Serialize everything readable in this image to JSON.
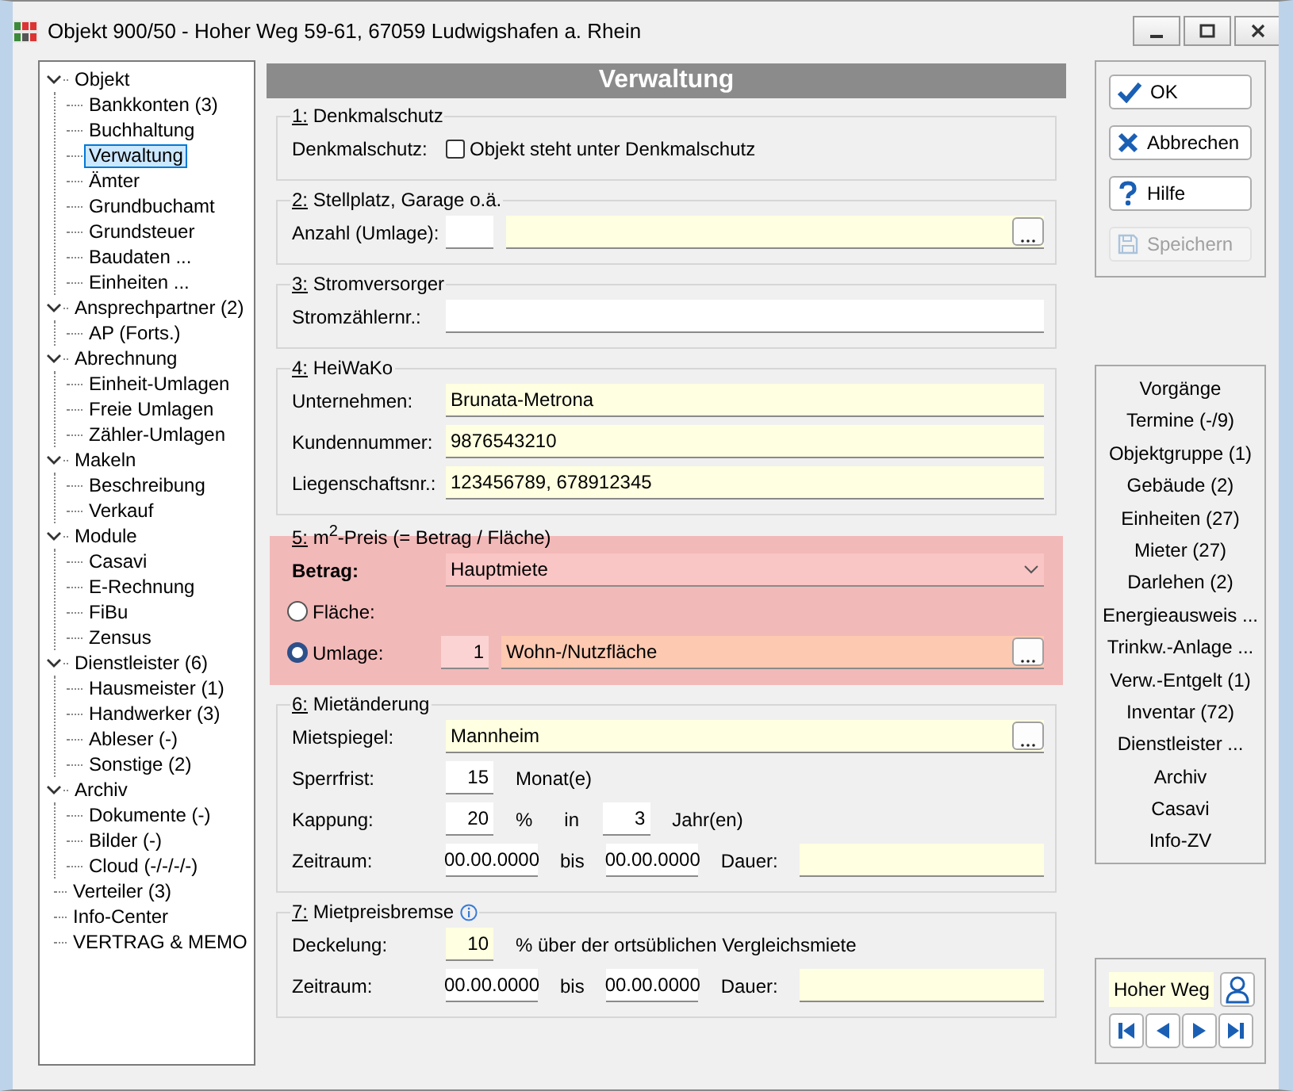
{
  "window": {
    "title": "Objekt 900/50 - Hoher Weg 59-61, 67059 Ludwigshafen a. Rhein"
  },
  "tree": [
    {
      "label": "Objekt",
      "expanded": true,
      "selected": false,
      "children": [
        {
          "label": "Bankkonten (3)",
          "selected": false
        },
        {
          "label": "Buchhaltung",
          "selected": false
        },
        {
          "label": "Verwaltung",
          "selected": true
        },
        {
          "label": "Ämter",
          "selected": false
        },
        {
          "label": "Grundbuchamt",
          "selected": false
        },
        {
          "label": "Grundsteuer",
          "selected": false
        },
        {
          "label": "Baudaten ...",
          "selected": false
        },
        {
          "label": "Einheiten ...",
          "selected": false
        }
      ]
    },
    {
      "label": "Ansprechpartner (2)",
      "expanded": true,
      "selected": false,
      "children": [
        {
          "label": "AP (Forts.)",
          "selected": false
        }
      ]
    },
    {
      "label": "Abrechnung",
      "expanded": true,
      "selected": false,
      "children": [
        {
          "label": "Einheit-Umlagen",
          "selected": false
        },
        {
          "label": "Freie Umlagen",
          "selected": false
        },
        {
          "label": "Zähler-Umlagen",
          "selected": false
        }
      ]
    },
    {
      "label": "Makeln",
      "expanded": true,
      "selected": false,
      "children": [
        {
          "label": "Beschreibung",
          "selected": false
        },
        {
          "label": "Verkauf",
          "selected": false
        }
      ]
    },
    {
      "label": "Module",
      "expanded": true,
      "selected": false,
      "children": [
        {
          "label": "Casavi",
          "selected": false
        },
        {
          "label": "E-Rechnung",
          "selected": false
        },
        {
          "label": "FiBu",
          "selected": false
        },
        {
          "label": "Zensus",
          "selected": false
        }
      ]
    },
    {
      "label": "Dienstleister (6)",
      "expanded": true,
      "selected": false,
      "children": [
        {
          "label": "Hausmeister (1)",
          "selected": false
        },
        {
          "label": "Handwerker (3)",
          "selected": false
        },
        {
          "label": "Ableser (-)",
          "selected": false
        },
        {
          "label": "Sonstige (2)",
          "selected": false
        }
      ]
    },
    {
      "label": "Archiv",
      "expanded": true,
      "selected": false,
      "children": [
        {
          "label": "Dokumente (-)",
          "selected": false
        },
        {
          "label": "Bilder (-)",
          "selected": false
        },
        {
          "label": "Cloud (-/-/-/-)",
          "selected": false
        }
      ]
    },
    {
      "label": "Verteiler (3)",
      "selected": false
    },
    {
      "label": "Info-Center",
      "selected": false
    },
    {
      "label": "VERTRAG & MEMO",
      "selected": false
    }
  ],
  "panel": {
    "title": "Verwaltung",
    "sections": [
      {
        "title": "1: Denkmalschutz",
        "highlighted": false,
        "info": false,
        "rows": [
          {
            "items": [
              {
                "kind": "label",
                "text": "Denkmalschutz:"
              },
              {
                "kind": "checkbox",
                "text": "Objekt steht unter Denkmalschutz",
                "checked": false
              }
            ]
          }
        ]
      },
      {
        "title": "2: Stellplatz, Garage o.ä.",
        "highlighted": false,
        "info": false,
        "rows": [
          {
            "items": [
              {
                "kind": "label",
                "text": "Anzahl (Umlage):"
              },
              {
                "kind": "number",
                "color": "#ffffff"
              },
              {
                "kind": "lookup",
                "color": "#ffffe1"
              }
            ]
          }
        ]
      },
      {
        "title": "3: Stromversorger",
        "highlighted": false,
        "info": false,
        "rows": [
          {
            "items": [
              {
                "kind": "label",
                "text": "Stromzählernr.:"
              },
              {
                "kind": "input",
                "color": "#ffffff"
              }
            ]
          }
        ]
      },
      {
        "title": "4: HeiWaKo",
        "highlighted": false,
        "info": false,
        "rows": [
          {
            "items": [
              {
                "kind": "label",
                "text": "Unternehmen:"
              },
              {
                "kind": "input",
                "value": "Brunata-Metrona",
                "color": "#ffffe1"
              }
            ]
          },
          {
            "items": [
              {
                "kind": "label",
                "text": "Kundennummer:"
              },
              {
                "kind": "input",
                "value": "9876543210",
                "color": "#ffffe1"
              }
            ]
          },
          {
            "items": [
              {
                "kind": "label",
                "text": "Liegenschaftsnr.:"
              },
              {
                "kind": "input",
                "value": "123456789, 678912345",
                "color": "#ffffe1"
              }
            ]
          }
        ]
      },
      {
        "title": "5: m$^{2}$-Preis (= Betrag / Fläche)",
        "highlighted": true,
        "info": false,
        "rows": [
          {
            "items": [
              {
                "kind": "strong-label",
                "text": "Betrag:"
              },
              {
                "kind": "select",
                "value": "Hauptmiete",
                "color": "#fac5c5"
              }
            ]
          },
          {
            "items": [
              {
                "kind": "radio",
                "text": "Fläche:",
                "selected": false
              }
            ]
          },
          {
            "items": [
              {
                "kind": "radio",
                "text": "Umlage:",
                "selected": true
              },
              {
                "kind": "number",
                "value": "1",
                "color": "#fcd3d3"
              },
              {
                "kind": "lookup",
                "value": "Wohn-/Nutzfläche",
                "color": "#fdc9b1"
              }
            ]
          }
        ]
      },
      {
        "title": "6: Mietänderung",
        "highlighted": false,
        "info": false,
        "rows": [
          {
            "items": [
              {
                "kind": "label",
                "text": "Mietspiegel:"
              },
              {
                "kind": "lookup",
                "value": "Mannheim",
                "color": "#ffffe1"
              }
            ]
          },
          {
            "items": [
              {
                "kind": "label",
                "text": "Sperrfrist:"
              },
              {
                "kind": "number",
                "value": "15",
                "color": "#ffffff"
              },
              {
                "kind": "text",
                "text": "Monat(e)"
              }
            ]
          },
          {
            "items": [
              {
                "kind": "label",
                "text": "Kappung:"
              },
              {
                "kind": "number",
                "value": "20",
                "color": "#ffffff"
              },
              {
                "kind": "text",
                "text": "%"
              },
              {
                "kind": "text",
                "text": "in"
              },
              {
                "kind": "number",
                "value": "3",
                "color": "#ffffff"
              },
              {
                "kind": "text",
                "text": "Jahr(en)"
              }
            ]
          },
          {
            "items": [
              {
                "kind": "label",
                "text": "Zeitraum:"
              },
              {
                "kind": "date",
                "value": "00.00.0000",
                "color": "#ffffff"
              },
              {
                "kind": "text",
                "text": "bis"
              },
              {
                "kind": "date",
                "value": "00.00.0000",
                "color": "#ffffff"
              },
              {
                "kind": "text",
                "text": "Dauer:"
              },
              {
                "kind": "input",
                "color": "#ffffe1"
              }
            ]
          }
        ]
      },
      {
        "title": "7: Mietpreisbremse",
        "highlighted": false,
        "info": true,
        "rows": [
          {
            "items": [
              {
                "kind": "label",
                "text": "Deckelung:"
              },
              {
                "kind": "number",
                "value": "10",
                "color": "#ffffe1"
              },
              {
                "kind": "text",
                "text": "% über der ortsüblichen Vergleichsmiete"
              }
            ]
          },
          {
            "items": [
              {
                "kind": "label",
                "text": "Zeitraum:"
              },
              {
                "kind": "date",
                "value": "00.00.0000",
                "color": "#ffffff"
              },
              {
                "kind": "text",
                "text": "bis"
              },
              {
                "kind": "date",
                "value": "00.00.0000",
                "color": "#ffffff"
              },
              {
                "kind": "text",
                "text": "Dauer:"
              },
              {
                "kind": "input",
                "color": "#ffffe1"
              }
            ]
          }
        ]
      }
    ]
  },
  "actions": [
    {
      "kind": "ok",
      "label": "OK",
      "disabled": false
    },
    {
      "kind": "cancel",
      "label": "Abbrechen",
      "disabled": false
    },
    {
      "kind": "help",
      "label": "Hilfe",
      "disabled": false
    },
    {
      "kind": "save",
      "label": "Speichern",
      "disabled": true
    }
  ],
  "links": [
    "Vorgänge",
    "Termine (-/9)",
    "Objektgruppe (1)",
    "Gebäude (2)",
    "Einheiten (27)",
    "Mieter (27)",
    "Darlehen (2)",
    "Energieausweis ...",
    "Trinkw.-Anlage ...",
    "Verw.-Entgelt (1)",
    "Inventar (72)",
    "Dienstleister ...",
    "Archiv",
    "Casavi",
    "Info-ZV"
  ],
  "navigator": {
    "value": "Hoher Weg"
  }
}
